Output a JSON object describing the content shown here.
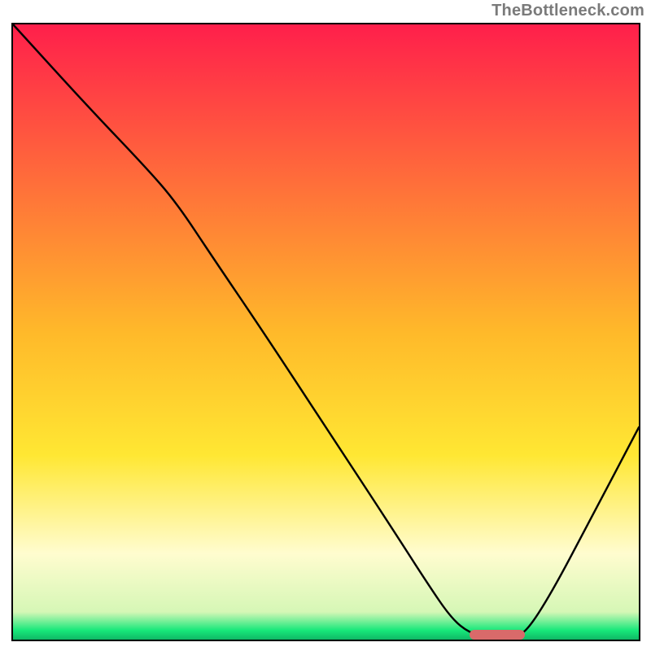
{
  "watermark": "TheBottleneck.com",
  "colors": {
    "top": "#ff1f4b",
    "mid": "#ffd21f",
    "light": "#fffbb0",
    "green": "#17e87a",
    "border": "#000000",
    "curve": "#000000",
    "marker": "#d96a6a"
  },
  "marker": {
    "x_frac": 0.73,
    "width_frac": 0.088,
    "y_frac": 0.992
  },
  "chart_data": {
    "type": "line",
    "title": "",
    "xlabel": "",
    "ylabel": "",
    "xlim": [
      0,
      1
    ],
    "ylim": [
      0,
      1
    ],
    "gradient_stops": [
      {
        "offset": 0.0,
        "color": "#ff1f4b"
      },
      {
        "offset": 0.5,
        "color": "#ffb92a"
      },
      {
        "offset": 0.7,
        "color": "#ffe733"
      },
      {
        "offset": 0.86,
        "color": "#fffccf"
      },
      {
        "offset": 0.955,
        "color": "#d6f7b6"
      },
      {
        "offset": 0.985,
        "color": "#17e87a"
      },
      {
        "offset": 1.0,
        "color": "#0fb865"
      }
    ],
    "series": [
      {
        "name": "bottleneck-curve",
        "points": [
          {
            "x": 0.0,
            "y": 1.0
          },
          {
            "x": 0.12,
            "y": 0.866
          },
          {
            "x": 0.21,
            "y": 0.77
          },
          {
            "x": 0.26,
            "y": 0.712
          },
          {
            "x": 0.32,
            "y": 0.62
          },
          {
            "x": 0.4,
            "y": 0.5
          },
          {
            "x": 0.5,
            "y": 0.345
          },
          {
            "x": 0.6,
            "y": 0.19
          },
          {
            "x": 0.66,
            "y": 0.095
          },
          {
            "x": 0.7,
            "y": 0.035
          },
          {
            "x": 0.73,
            "y": 0.01
          },
          {
            "x": 0.76,
            "y": 0.005
          },
          {
            "x": 0.8,
            "y": 0.005
          },
          {
            "x": 0.82,
            "y": 0.012
          },
          {
            "x": 0.86,
            "y": 0.075
          },
          {
            "x": 0.92,
            "y": 0.19
          },
          {
            "x": 1.0,
            "y": 0.345
          }
        ]
      }
    ],
    "optimum_range_x": [
      0.73,
      0.818
    ]
  }
}
